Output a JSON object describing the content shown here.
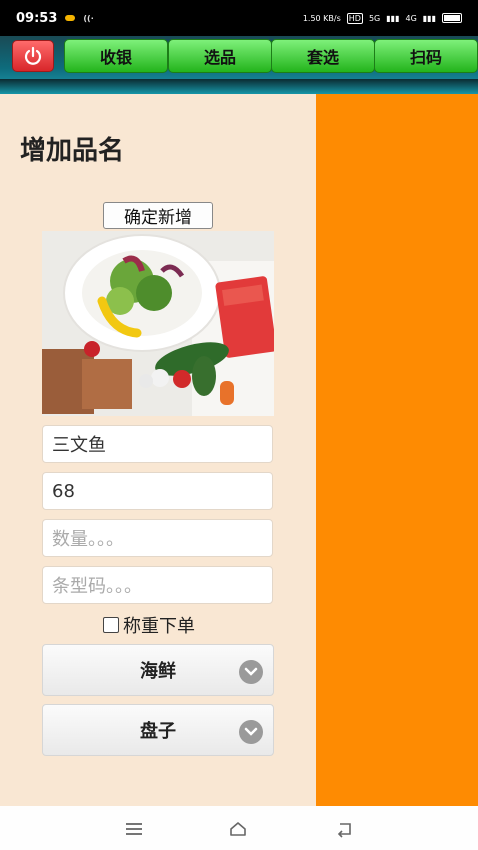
{
  "status_bar": {
    "time": "09:53",
    "net_speed": "1.50 KB/s",
    "hd_label": "HD",
    "signal_5g": "5G",
    "signal_4g": "4G"
  },
  "toolbar": {
    "tabs": [
      {
        "label": "收银"
      },
      {
        "label": "选品"
      },
      {
        "label": "套选"
      },
      {
        "label": "扫码"
      }
    ]
  },
  "form": {
    "title": "增加品名",
    "confirm_label": "确定新增",
    "name_value": "三文鱼",
    "price_value": "68",
    "quantity_placeholder": "数量。。。",
    "barcode_placeholder": "条型码。。。",
    "weigh_label": "称重下单",
    "category_select": "海鲜",
    "unit_select": "盘子"
  },
  "colors": {
    "left_bg": "#f9e7d3",
    "right_bg": "#fe8b02",
    "tab_green": "#23b41c",
    "power_red": "#d8262a"
  },
  "icons": {
    "power": "power-icon",
    "chevron": "chevron-down-icon",
    "nav_menu": "menu-icon",
    "nav_home": "home-icon",
    "nav_back": "back-icon"
  }
}
